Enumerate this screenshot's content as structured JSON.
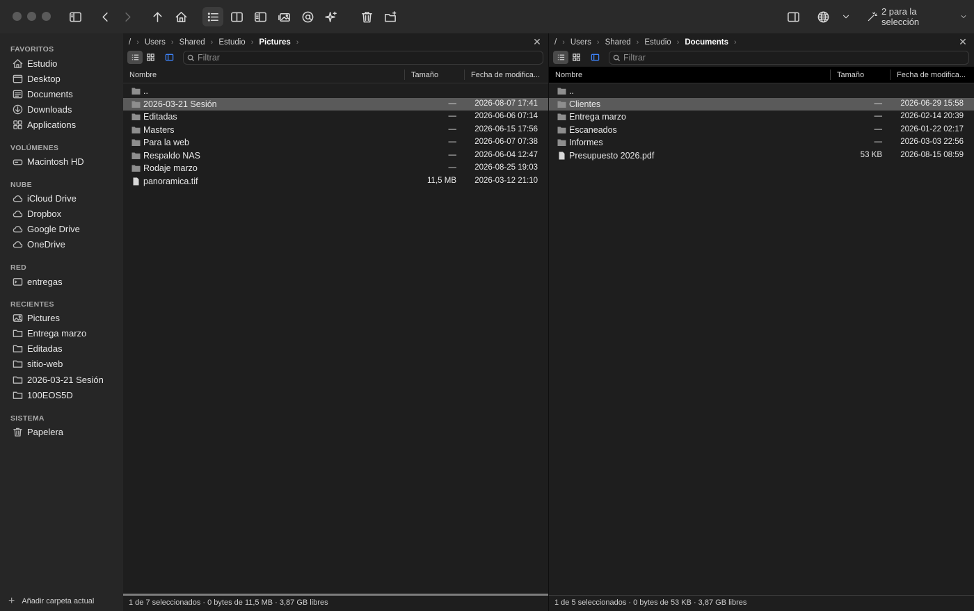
{
  "toolbar": {
    "selection_menu": "2 para la selección"
  },
  "sidebar": {
    "sections": {
      "favoritos": "FAVORITOS",
      "volumenes": "VOLÚMENES",
      "nube": "NUBE",
      "red": "RED",
      "recientes": "RECIENTES",
      "sistema": "SISTEMA"
    },
    "favoritos": [
      "Estudio",
      "Desktop",
      "Documents",
      "Downloads",
      "Applications"
    ],
    "volumenes": [
      "Macintosh HD"
    ],
    "nube": [
      "iCloud Drive",
      "Dropbox",
      "Google Drive",
      "OneDrive"
    ],
    "red": [
      "entregas"
    ],
    "recientes": [
      "Pictures",
      "Entrega marzo",
      "Editadas",
      "sitio-web",
      "2026-03-21 Sesión",
      "100EOS5D"
    ],
    "sistema": [
      "Papelera"
    ],
    "add_label": "Añadir carpeta actual"
  },
  "left_pane": {
    "breadcrumb": [
      "/",
      "Users",
      "Shared",
      "Estudio",
      "Pictures"
    ],
    "filter_placeholder": "Filtrar",
    "columns": {
      "name": "Nombre",
      "size": "Tamaño",
      "date": "Fecha de modifica..."
    },
    "rows": [
      {
        "name": "..",
        "size": "",
        "date": "",
        "kind": "folder"
      },
      {
        "name": "2026-03-21 Sesión",
        "size": "—",
        "date": "2026-08-07 17:41",
        "kind": "folder",
        "selected": true
      },
      {
        "name": "Editadas",
        "size": "—",
        "date": "2026-06-06 07:14",
        "kind": "folder"
      },
      {
        "name": "Masters",
        "size": "—",
        "date": "2026-06-15 17:56",
        "kind": "folder"
      },
      {
        "name": "Para la web",
        "size": "—",
        "date": "2026-06-07 07:38",
        "kind": "folder"
      },
      {
        "name": "Respaldo NAS",
        "size": "—",
        "date": "2026-06-04 12:47",
        "kind": "folder"
      },
      {
        "name": "Rodaje marzo",
        "size": "—",
        "date": "2026-08-25 19:03",
        "kind": "folder"
      },
      {
        "name": "panoramica.tif",
        "size": "11,5 MB",
        "date": "2026-03-12 21:10",
        "kind": "file"
      }
    ],
    "status": "1 de 7 seleccionados · 0 bytes de 11,5 MB · 3,87 GB libres"
  },
  "right_pane": {
    "breadcrumb": [
      "/",
      "Users",
      "Shared",
      "Estudio",
      "Documents"
    ],
    "filter_placeholder": "Filtrar",
    "columns": {
      "name": "Nombre",
      "size": "Tamaño",
      "date": "Fecha de modifica..."
    },
    "rows": [
      {
        "name": "..",
        "size": "",
        "date": "",
        "kind": "folder"
      },
      {
        "name": "Clientes",
        "size": "—",
        "date": "2026-06-29 15:58",
        "kind": "folder",
        "selected": true
      },
      {
        "name": "Entrega marzo",
        "size": "—",
        "date": "2026-02-14 20:39",
        "kind": "folder"
      },
      {
        "name": "Escaneados",
        "size": "—",
        "date": "2026-01-22 02:17",
        "kind": "folder"
      },
      {
        "name": "Informes",
        "size": "—",
        "date": "2026-03-03 22:56",
        "kind": "folder"
      },
      {
        "name": "Presupuesto 2026.pdf",
        "size": "53 KB",
        "date": "2026-08-15 08:59",
        "kind": "file"
      }
    ],
    "status": "1 de 5 seleccionados · 0 bytes de 53 KB · 3,87 GB libres"
  }
}
